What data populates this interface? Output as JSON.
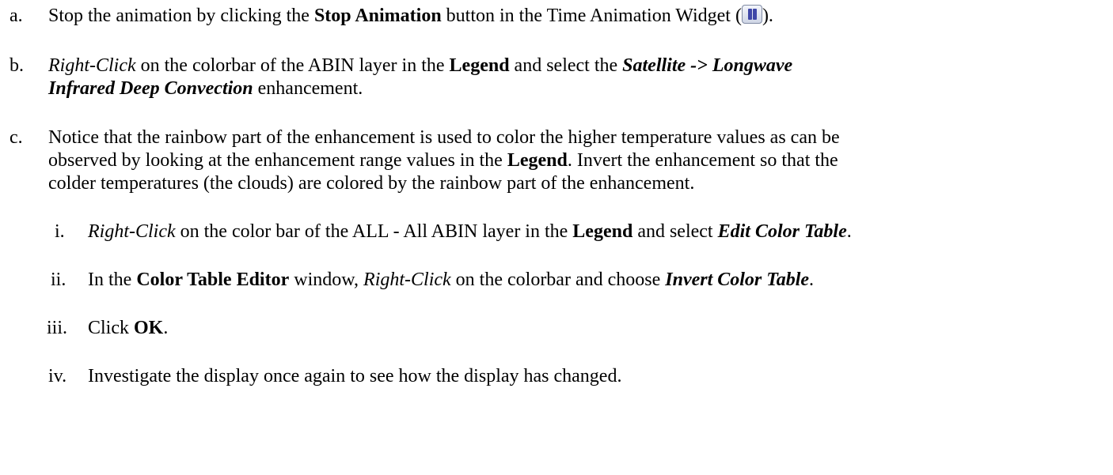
{
  "steps": {
    "a": {
      "marker": "a.",
      "t1": "Stop the animation by clicking the ",
      "b1": "Stop Animation",
      "t2": " button in the Time Animation Widget (",
      "icon": "pause-icon",
      "t3": ")."
    },
    "b": {
      "marker": "b.",
      "i1": "Right-Click",
      "t1": " on the colorbar of the ABIN layer in the ",
      "b1": "Legend",
      "t2": " and select the ",
      "bi1": "Satellite -> Longwave",
      "bi2": "Infrared Deep Convection",
      "t3": " enhancement."
    },
    "c": {
      "marker": "c.",
      "l1": "Notice that the rainbow part of the enhancement is used to color the higher temperature values as can be",
      "l2a": "observed by looking at the enhancement range values in the ",
      "l2b": "Legend",
      "l2c": ".  Invert the enhancement so that the",
      "l3": "colder temperatures (the clouds) are colored by the rainbow part of the enhancement."
    },
    "sub": {
      "i": {
        "marker": "i.",
        "i1": "Right-Click",
        "t1": " on the color bar of the ALL - All ABIN layer in the ",
        "b1": "Legend",
        "t2": " and select ",
        "bi1": "Edit Color Table",
        "t3": "."
      },
      "ii": {
        "marker": "ii.",
        "t1": "In the ",
        "b1": "Color Table Editor",
        "t2": " window, ",
        "i1": "Right-Click",
        "t3": " on the colorbar and choose ",
        "bi1": "Invert Color Table",
        "t4": "."
      },
      "iii": {
        "marker": "iii.",
        "t1": "Click ",
        "b1": "OK",
        "t2": "."
      },
      "iv": {
        "marker": "iv.",
        "t1": "Investigate the display once again to see how the display has changed."
      }
    }
  }
}
